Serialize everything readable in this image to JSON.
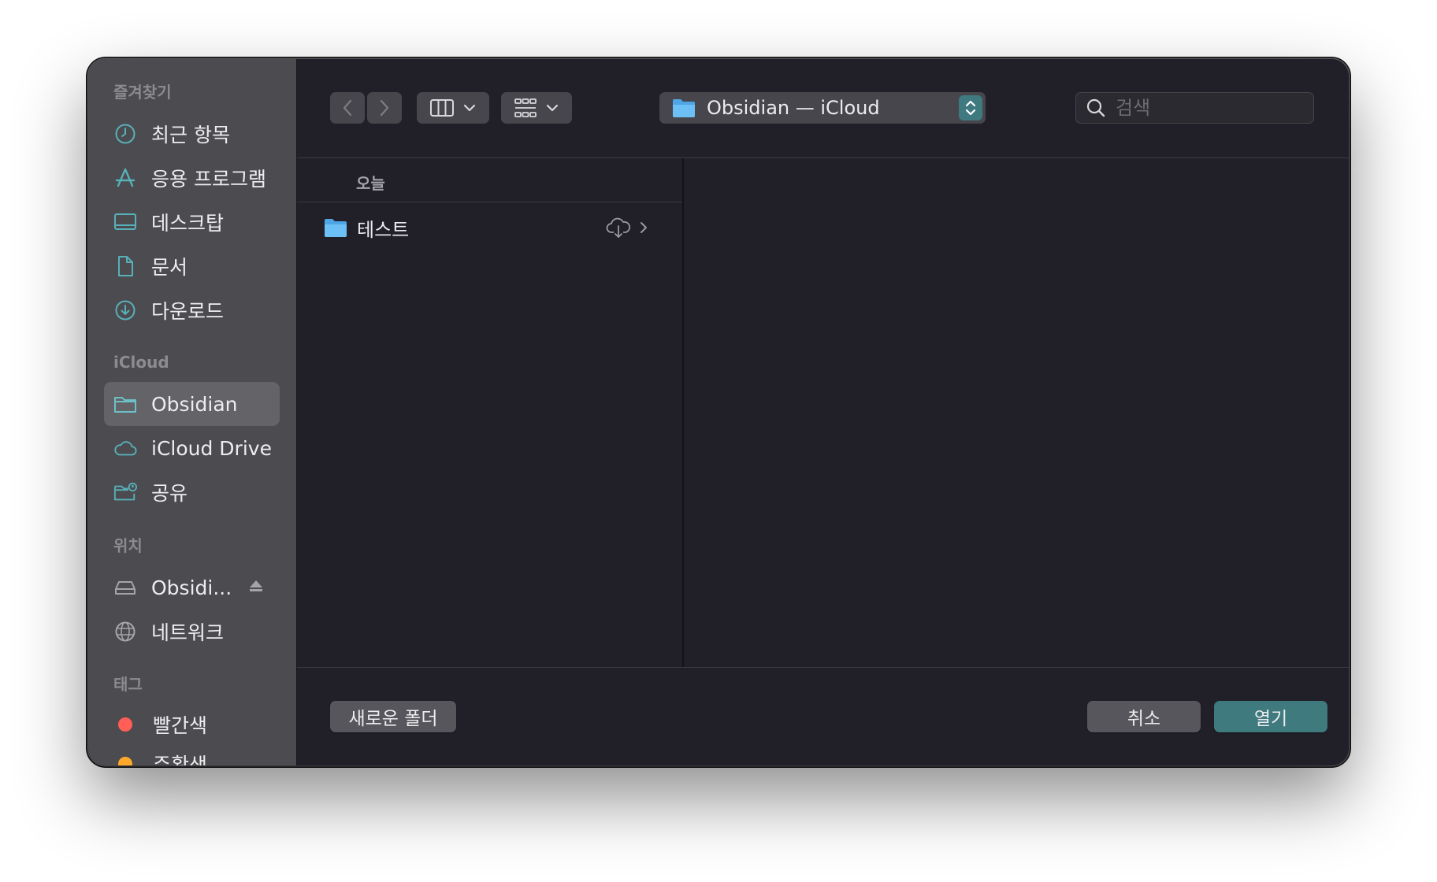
{
  "sidebar": {
    "favorites_heading": "즐겨찾기",
    "favorites": [
      {
        "label": "최근 항목",
        "icon": "clock-icon"
      },
      {
        "label": "응용 프로그램",
        "icon": "applications-icon"
      },
      {
        "label": "데스크탑",
        "icon": "desktop-icon"
      },
      {
        "label": "문서",
        "icon": "document-icon"
      },
      {
        "label": "다운로드",
        "icon": "download-icon"
      }
    ],
    "icloud_heading": "iCloud",
    "icloud": [
      {
        "label": "Obsidian",
        "icon": "folder-icon",
        "selected": true
      },
      {
        "label": "iCloud Drive",
        "icon": "cloud-icon"
      },
      {
        "label": "공유",
        "icon": "shared-folder-icon"
      }
    ],
    "locations_heading": "위치",
    "locations": [
      {
        "label": "Obsidi...",
        "icon": "drive-icon",
        "eject": true
      },
      {
        "label": "네트워크",
        "icon": "network-globe-icon"
      }
    ],
    "tags_heading": "태그",
    "tags": [
      {
        "label": "빨간색",
        "color": "#ff5f57"
      },
      {
        "label": "주황색",
        "color": "#ffa92a"
      }
    ]
  },
  "toolbar": {
    "path_label": "Obsidian — iCloud",
    "search_placeholder": "검색"
  },
  "browser": {
    "column_header": "오늘",
    "items": [
      {
        "name": "테스트",
        "icon": "folder-icon",
        "status": "cloud-download-icon"
      }
    ]
  },
  "footer": {
    "new_folder_label": "새로운 폴더",
    "cancel_label": "취소",
    "open_label": "열기"
  },
  "colors": {
    "accent": "#3f7a7f",
    "folder_blue": "#5ab4f0"
  }
}
